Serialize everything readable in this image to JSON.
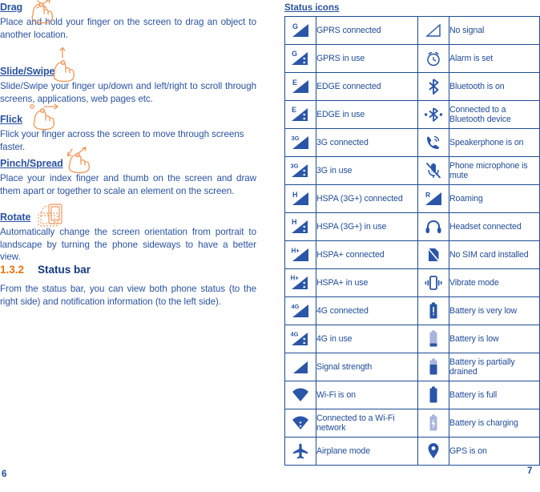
{
  "document": {
    "left_page_number": "6",
    "right_page_number": "7",
    "accent_orange": "#e8740c",
    "text_blue": "#2a52a0",
    "icon_blue": "#2b56a7"
  },
  "gestures": [
    {
      "heading": "Drag",
      "icon": "drag-hand-icon",
      "body": "Place and hold your finger on the screen to drag an object to another location."
    },
    {
      "heading": "Slide/Swipe",
      "icon": "slide-swipe-hand-icon",
      "body": "Slide/Swipe your finger up/down and left/right to scroll through screens, applications, web pages etc."
    },
    {
      "heading": "Flick",
      "icon": "flick-hand-icon",
      "body": "Flick your finger across the screen to move through screens faster."
    },
    {
      "heading": "Pinch/Spread",
      "icon": "pinch-spread-hand-icon",
      "body": "Place your index finger and thumb on the screen and draw them apart or together to scale an element on the screen."
    },
    {
      "heading": "Rotate",
      "icon": "rotate-device-icon",
      "body": "Automatically change the screen orientation from portrait to landscape by turning the phone sideways to have a better view."
    }
  ],
  "section": {
    "number": "1.3.2",
    "title": "Status bar",
    "body": "From the status bar, you can view both phone status (to the right side) and notification information (to the left side)."
  },
  "status_table": {
    "heading": "Status icons",
    "rows": [
      {
        "left": {
          "icon": "gprs-connected-icon",
          "label": "GPRS connected"
        },
        "right": {
          "icon": "no-signal-icon",
          "label": "No signal"
        }
      },
      {
        "left": {
          "icon": "gprs-in-use-icon",
          "label": "GPRS in use"
        },
        "right": {
          "icon": "alarm-clock-icon",
          "label": "Alarm is set"
        }
      },
      {
        "left": {
          "icon": "edge-connected-icon",
          "label": "EDGE connected"
        },
        "right": {
          "icon": "bluetooth-on-icon",
          "label": "Bluetooth is on"
        }
      },
      {
        "left": {
          "icon": "edge-in-use-icon",
          "label": "EDGE in use"
        },
        "right": {
          "icon": "bluetooth-connected-icon",
          "label": "Connected to a Bluetooth device"
        }
      },
      {
        "left": {
          "icon": "3g-connected-icon",
          "label": "3G connected"
        },
        "right": {
          "icon": "speakerphone-icon",
          "label": "Speakerphone is on"
        }
      },
      {
        "left": {
          "icon": "3g-in-use-icon",
          "label": "3G in use"
        },
        "right": {
          "icon": "microphone-mute-icon",
          "label": "Phone microphone is mute"
        }
      },
      {
        "left": {
          "icon": "hspa-connected-icon",
          "label": "HSPA (3G+) connected"
        },
        "right": {
          "icon": "roaming-icon",
          "label": "Roaming"
        }
      },
      {
        "left": {
          "icon": "hspa-in-use-icon",
          "label": "HSPA (3G+) in use"
        },
        "right": {
          "icon": "headset-icon",
          "label": "Headset connected"
        }
      },
      {
        "left": {
          "icon": "hspa-plus-connected-icon",
          "label": "HSPA+ connected"
        },
        "right": {
          "icon": "no-sim-card-icon",
          "label": "No SIM card installed"
        }
      },
      {
        "left": {
          "icon": "hspa-plus-in-use-icon",
          "label": "HSPA+ in use"
        },
        "right": {
          "icon": "vibrate-mode-icon",
          "label": "Vibrate mode"
        }
      },
      {
        "left": {
          "icon": "4g-connected-icon",
          "label": "4G connected"
        },
        "right": {
          "icon": "battery-very-low-icon",
          "label": "Battery is very low"
        }
      },
      {
        "left": {
          "icon": "4g-in-use-icon",
          "label": "4G in use"
        },
        "right": {
          "icon": "battery-low-icon",
          "label": "Battery is low"
        }
      },
      {
        "left": {
          "icon": "signal-strength-icon",
          "label": "Signal strength"
        },
        "right": {
          "icon": "battery-partial-icon",
          "label": "Battery is partially drained"
        }
      },
      {
        "left": {
          "icon": "wifi-on-icon",
          "label": "Wi-Fi is on"
        },
        "right": {
          "icon": "battery-full-icon",
          "label": "Battery is full"
        }
      },
      {
        "left": {
          "icon": "wifi-connected-icon",
          "label": "Connected to a Wi-Fi network"
        },
        "right": {
          "icon": "battery-charging-icon",
          "label": "Battery is charging"
        }
      },
      {
        "left": {
          "icon": "airplane-mode-icon",
          "label": "Airplane mode"
        },
        "right": {
          "icon": "gps-on-icon",
          "label": "GPS is on"
        }
      }
    ]
  }
}
